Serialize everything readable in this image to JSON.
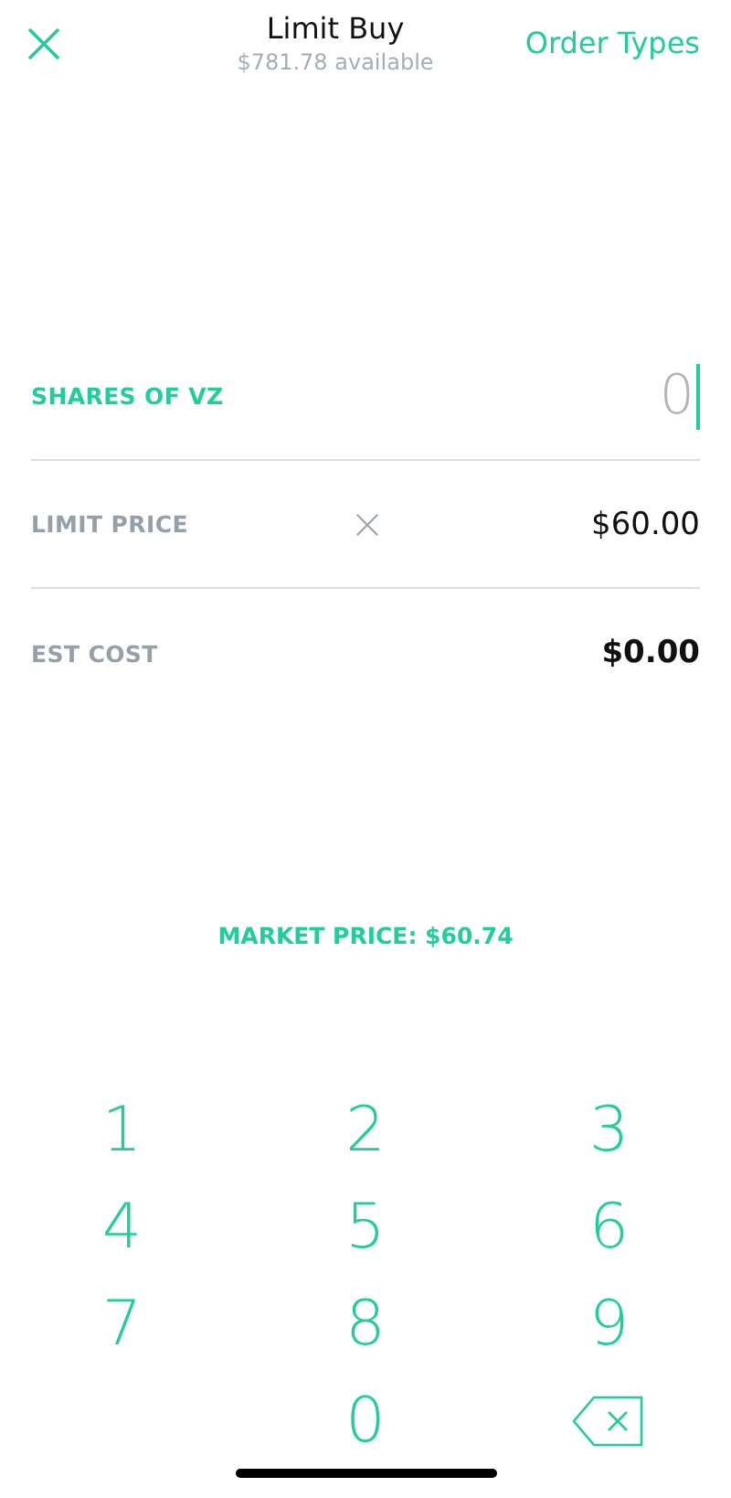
{
  "header": {
    "title": "Limit Buy",
    "subtitle": "$781.78 available",
    "action": "Order Types"
  },
  "rows": [
    {
      "kind": "input",
      "label": "SHARES OF VZ",
      "placeholder": "0",
      "focused": true
    },
    {
      "kind": "clearable",
      "label": "LIMIT PRICE",
      "value": "$60.00",
      "focused": false
    },
    {
      "kind": "total",
      "label": "EST COST",
      "value": "$0.00",
      "focused": false
    }
  ],
  "market_price": "MARKET PRICE: $60.74",
  "keys": [
    {
      "kind": "digit",
      "label": "1"
    },
    {
      "kind": "digit",
      "label": "2"
    },
    {
      "kind": "digit",
      "label": "3"
    },
    {
      "kind": "digit",
      "label": "4"
    },
    {
      "kind": "digit",
      "label": "5"
    },
    {
      "kind": "digit",
      "label": "6"
    },
    {
      "kind": "digit",
      "label": "7"
    },
    {
      "kind": "digit",
      "label": "8"
    },
    {
      "kind": "digit",
      "label": "9"
    },
    {
      "kind": "blank"
    },
    {
      "kind": "digit",
      "label": "0"
    },
    {
      "kind": "backspace"
    }
  ]
}
